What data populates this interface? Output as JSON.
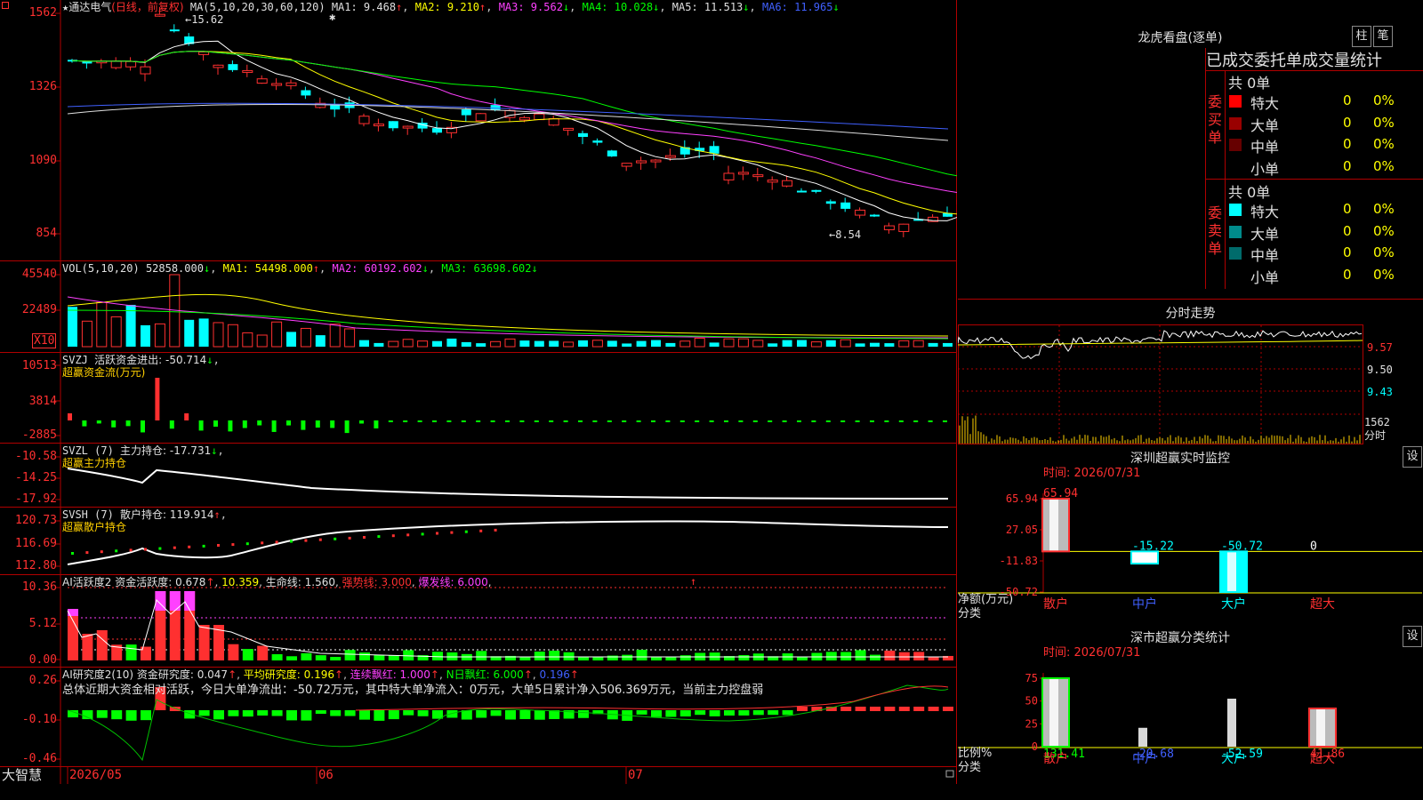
{
  "stock": {
    "icon": "star-icon",
    "name": "通达电气",
    "period": "(日线，前复权)"
  },
  "ma_header": {
    "label": "MA(5,10,20,30,60,120)",
    "ma1": "MA1: 9.468",
    "ma2": "MA2: 9.210",
    "ma3": "MA3: 9.562",
    "ma4": "MA4: 10.028",
    "ma5": "MA5: 11.513",
    "ma6": "MA6: 11.965",
    "arrow_up": "↑",
    "arrow_down": "↓"
  },
  "price_axis": [
    "1562",
    "1326",
    "1090",
    "854"
  ],
  "price_marks": {
    "high": "15.62",
    "low": "8.54"
  },
  "vol_header": {
    "label": "VOL(5,10,20)",
    "value": "52858.000",
    "ma1": "MA1: 54498.000",
    "ma2": "MA2: 60192.602",
    "ma3": "MA3: 63698.602"
  },
  "vol_axis": [
    "45540",
    "22489"
  ],
  "vol_unit": "X10",
  "svzj": {
    "label": "SVZJ",
    "title": "活跃资金进出: -50.714",
    "subtitle": "超赢资金流(万元)",
    "axis": [
      "10513",
      "3814",
      "-2885"
    ]
  },
  "svzl": {
    "label": "SVZL (7)",
    "title": "主力持仓: -17.731",
    "subtitle": "超赢主力持仓",
    "axis": [
      "-10.58",
      "-14.25",
      "-17.92"
    ]
  },
  "svsh": {
    "label": "SVSH (7)",
    "title": "散户持仓: 119.914",
    "subtitle": "超赢散户持仓",
    "axis": [
      "120.73",
      "116.69",
      "112.80"
    ]
  },
  "ai_active": {
    "label": "AI活跃度2",
    "activity": "资金活跃度: 0.678",
    "v2": "10.359",
    "life": "生命线: 1.560",
    "strong": "强势线: 3.000",
    "burst": "爆发线: 6.000",
    "axis": [
      "10.36",
      "5.12",
      "0.00"
    ]
  },
  "ai_research": {
    "label": "AI研究度2(10)",
    "research": "资金研究度: 0.047",
    "avg": "平均研究度: 0.196",
    "cont": "连续飘红: 1.000",
    "nday": "N日飘红: 6.000",
    "v5": "0.196",
    "axis": [
      "0.26",
      "-0.10",
      "-0.46"
    ],
    "summary": "总体近期大资金相对活跃，今日大单净流出：-50.72万元，其中特大单净流入：0万元，大单5日累计净入506.369万元，当前主力控盘弱"
  },
  "date_axis": {
    "brand": "大智慧",
    "d1": "2026/05",
    "d2": "06",
    "d3": "07"
  },
  "longhu": {
    "title": "龙虎看盘(逐单)",
    "btn_column": "柱",
    "btn_stroke": "笔",
    "subtitle": "已成交委托单成交量统计",
    "buy": {
      "side": "委买单",
      "total": "共 0单",
      "rows": [
        {
          "name": "特大",
          "count": "0",
          "pct": "0%",
          "color": "#ff0000"
        },
        {
          "name": "大单",
          "count": "0",
          "pct": "0%",
          "color": "#990000"
        },
        {
          "name": "中单",
          "count": "0",
          "pct": "0%",
          "color": "#660000"
        },
        {
          "name": "小单",
          "count": "0",
          "pct": "0%",
          "color": "#000000"
        }
      ]
    },
    "sell": {
      "side": "委卖单",
      "total": "共 0单",
      "rows": [
        {
          "name": "特大",
          "count": "0",
          "pct": "0%",
          "color": "#00ffff"
        },
        {
          "name": "大单",
          "count": "0",
          "pct": "0%",
          "color": "#008b8b"
        },
        {
          "name": "中单",
          "count": "0",
          "pct": "0%",
          "color": "#006b6b"
        },
        {
          "name": "小单",
          "count": "0",
          "pct": "0%",
          "color": "#000000"
        }
      ]
    }
  },
  "intraday": {
    "title": "分时走势",
    "prices": [
      "9.57",
      "9.50",
      "9.43"
    ],
    "vol": "1562",
    "vol_label": "分时"
  },
  "sz_monitor": {
    "title": "深圳超赢实时监控",
    "btn": "设",
    "time": "时间: 2026/07/31",
    "axis": [
      "65.94",
      "27.05",
      "-11.83",
      "-50.72"
    ],
    "ylabel": "净额(万元)",
    "xlabel": "分类",
    "chart_data": {
      "type": "bar",
      "categories": [
        "散户",
        "中户",
        "大户",
        "超大"
      ],
      "values": [
        65.94,
        -15.22,
        -50.72,
        0
      ],
      "labels": [
        "65.94",
        "-15.22",
        "-50.72",
        "0"
      ],
      "ylim": [
        -50.72,
        65.94
      ]
    }
  },
  "sz_class": {
    "title": "深市超赢分类统计",
    "btn": "设",
    "time": "时间: 2026/07/31",
    "axis": [
      "75",
      "50",
      "25",
      "0"
    ],
    "ylabel": "比例%",
    "xlabel": "分类",
    "chart_data": {
      "type": "bar",
      "categories": [
        "散户",
        "中户",
        "大户",
        "超大"
      ],
      "values": [
        131.41,
        -20.68,
        -52.59,
        41.86
      ],
      "labels": [
        "131.41",
        "-20.68",
        "-52.59",
        "41.86"
      ],
      "ylim": [
        0,
        75
      ]
    }
  }
}
